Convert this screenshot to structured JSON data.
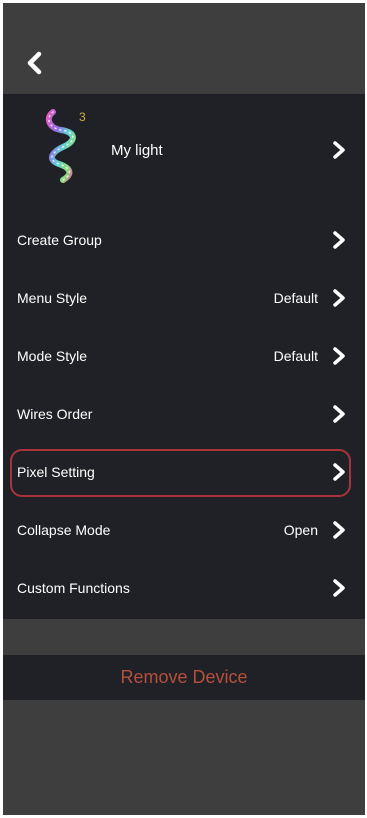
{
  "header": {
    "back_icon": "chevron-left-icon"
  },
  "device": {
    "name": "My light",
    "badge": "3",
    "icon": "spiral-light-icon"
  },
  "menu": [
    {
      "key": "create-group",
      "label": "Create Group",
      "value": ""
    },
    {
      "key": "menu-style",
      "label": "Menu Style",
      "value": "Default"
    },
    {
      "key": "mode-style",
      "label": "Mode Style",
      "value": "Default"
    },
    {
      "key": "wires-order",
      "label": "Wires Order",
      "value": ""
    },
    {
      "key": "pixel-setting",
      "label": "Pixel Setting",
      "value": "",
      "highlighted": true
    },
    {
      "key": "collapse-mode",
      "label": "Collapse Mode",
      "value": "Open"
    },
    {
      "key": "custom-functions",
      "label": "Custom Functions",
      "value": ""
    }
  ],
  "footer": {
    "remove_label": "Remove Device"
  },
  "colors": {
    "header_bg": "#3e3e3e",
    "list_bg": "#202126",
    "text": "#ffffff",
    "danger": "#b5503d",
    "highlight_border": "#a8343b",
    "badge": "#c9b33c"
  }
}
